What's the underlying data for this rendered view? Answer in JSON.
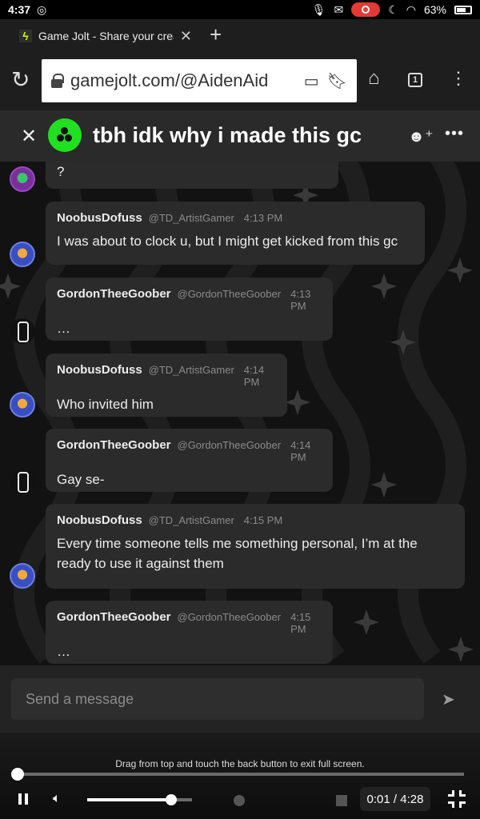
{
  "status_bar": {
    "time": "4:37",
    "battery": "63%"
  },
  "browser": {
    "tab_title": "Game Jolt - Share your crea",
    "url": "gamejolt.com/@AidenAid",
    "tab_count": "1"
  },
  "chat": {
    "title": "tbh idk why i made this gc",
    "first_message_fragment": "?",
    "messages": [
      {
        "author": "NoobusDofuss",
        "handle": "@TD_ArtistGamer",
        "time": "4:13 PM",
        "text": "I was about to clock u, but I might get kicked from this gc"
      },
      {
        "author": "GordonTheeGoober",
        "handle": "@GordonTheeGoober",
        "time": "4:13 PM",
        "text": "…"
      },
      {
        "author": "NoobusDofuss",
        "handle": "@TD_ArtistGamer",
        "time": "4:14 PM",
        "text": "Who invited him"
      },
      {
        "author": "GordonTheeGoober",
        "handle": "@GordonTheeGoober",
        "time": "4:14 PM",
        "text": "Gay se-"
      },
      {
        "author": "NoobusDofuss",
        "handle": "@TD_ArtistGamer",
        "time": "4:15 PM",
        "text": "Every time someone tells me something personal, I’m at the ready to use it against them"
      },
      {
        "author": "GordonTheeGoober",
        "handle": "@GordonTheeGoober",
        "time": "4:15 PM",
        "text": "…"
      }
    ],
    "composer_placeholder": "Send a message"
  },
  "player": {
    "hint": "Drag from top and touch the back button to exit full screen.",
    "timecode": "0:01 / 4:28",
    "progress": 0.004,
    "volume": 0.8
  },
  "colors": {
    "group_avatar": "#21e021",
    "header_bg": "#2a2a2a",
    "bubble_bg": "#2b2b2b",
    "record_badge": "#e53935"
  }
}
